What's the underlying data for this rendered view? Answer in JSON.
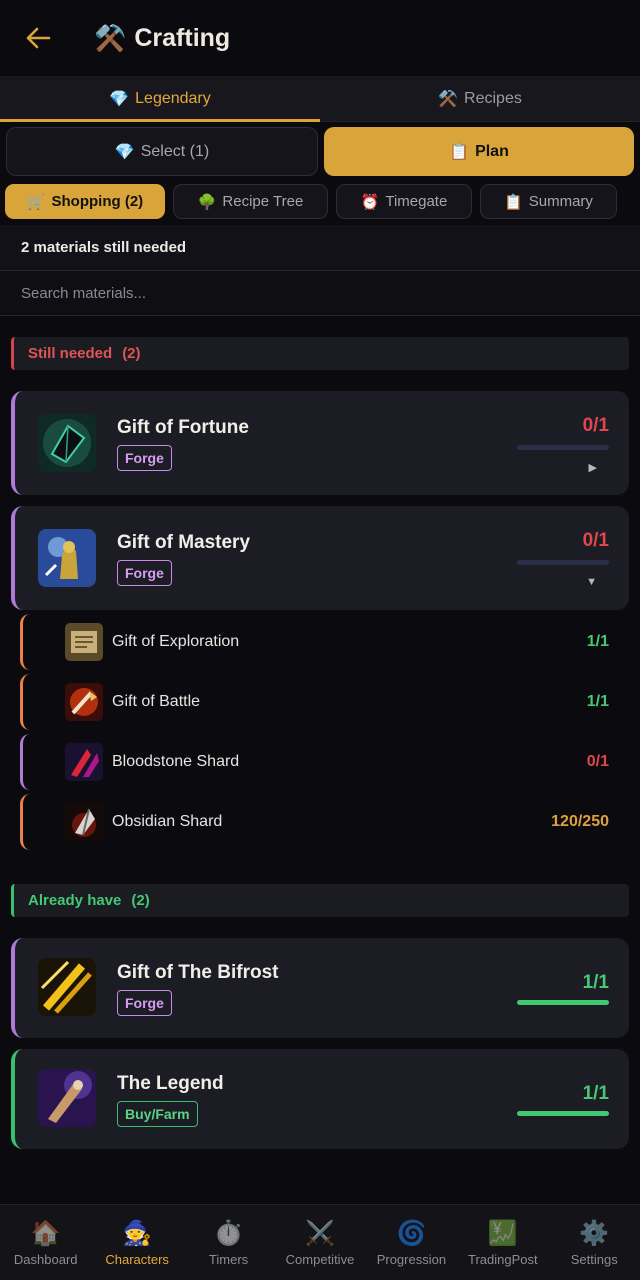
{
  "header": {
    "title": "Crafting",
    "title_icon": "hammer-pick-icon",
    "back_icon": "back-arrow-icon"
  },
  "main_tabs": [
    {
      "label": "Legendary",
      "icon": "gem-icon",
      "emoji": "💎",
      "active": true
    },
    {
      "label": "Recipes",
      "icon": "hammer-pick-icon",
      "emoji": "⚒️",
      "active": false
    }
  ],
  "modes": {
    "select": {
      "label": "Select (1)",
      "emoji": "💎"
    },
    "plan": {
      "label": "Plan",
      "emoji": "📋"
    }
  },
  "subtabs": [
    {
      "label": "Shopping (2)",
      "emoji": "🛒",
      "active": true
    },
    {
      "label": "Recipe Tree",
      "emoji": "🌳",
      "active": false
    },
    {
      "label": "Timegate",
      "emoji": "⏰",
      "active": false
    },
    {
      "label": "Summary",
      "emoji": "📋",
      "active": false
    }
  ],
  "status": "2 materials still needed",
  "search": {
    "placeholder": "Search materials..."
  },
  "still_needed": {
    "label": "Still needed",
    "count": "(2)",
    "items": [
      {
        "name": "Gift of Fortune",
        "badge": "Forge",
        "count": "0/1",
        "progress": 0,
        "chevron": "▶"
      },
      {
        "name": "Gift of Mastery",
        "badge": "Forge",
        "count": "0/1",
        "progress": 0,
        "chevron": "▼"
      }
    ],
    "sub_items": [
      {
        "name": "Gift of Exploration",
        "count": "1/1"
      },
      {
        "name": "Gift of Battle",
        "count": "1/1"
      },
      {
        "name": "Bloodstone Shard",
        "count": "0/1"
      },
      {
        "name": "Obsidian Shard",
        "count": "120/250"
      }
    ]
  },
  "already_have": {
    "label": "Already have",
    "count": "(2)",
    "items": [
      {
        "name": "Gift of The Bifrost",
        "badge": "Forge",
        "count": "1/1",
        "progress": 1
      },
      {
        "name": "The Legend",
        "badge": "Buy/Farm",
        "count": "1/1",
        "progress": 1
      }
    ]
  },
  "nav": [
    {
      "label": "Dashboard",
      "icon": "house-icon",
      "emoji": "🏠"
    },
    {
      "label": "Characters",
      "icon": "mage-icon",
      "emoji": "🧙",
      "active": true
    },
    {
      "label": "Timers",
      "icon": "stopwatch-icon",
      "emoji": "⏱️"
    },
    {
      "label": "Competitive",
      "icon": "crossed-swords-icon",
      "emoji": "⚔️"
    },
    {
      "label": "Progression",
      "icon": "spiral-icon",
      "emoji": "🌀"
    },
    {
      "label": "TradingPost",
      "icon": "chart-icon",
      "emoji": "💹"
    },
    {
      "label": "Settings",
      "icon": "gear-icon",
      "emoji": "⚙️"
    }
  ],
  "colors": {
    "accent": "#d9a53a",
    "need": "#e0474c",
    "have": "#46c874",
    "forge": "#c78be6"
  }
}
